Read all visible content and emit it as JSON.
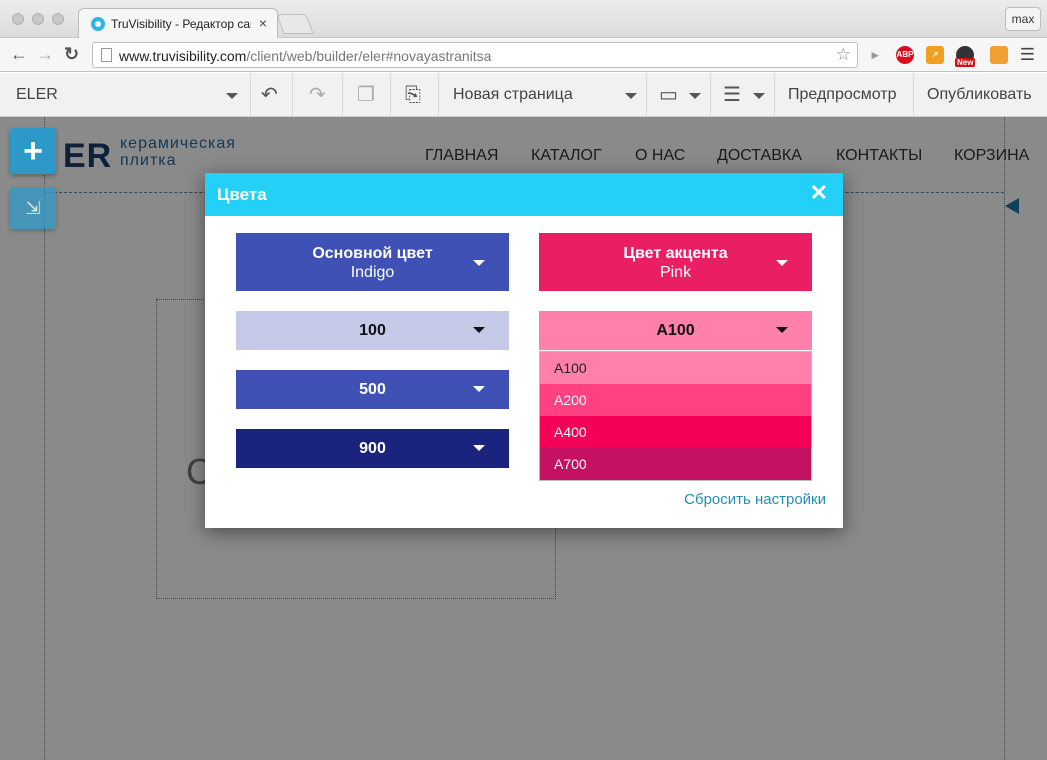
{
  "browser": {
    "tab_title": "TruVisibility - Редактор сай",
    "tab_close": "×",
    "profile": "max",
    "url_host": "www.truvisibility.com",
    "url_path": "/client/web/builder/eler#novayastranitsa",
    "extensions": [
      "volume-icon",
      "adblock-icon",
      "chart-icon",
      "new-badge-icon",
      "grid-icon"
    ],
    "adblock_label": "ABP",
    "new_label": "New"
  },
  "toolbar": {
    "site_name": "ELER",
    "page_select": "Новая страница",
    "preview": "Предпросмотр",
    "publish": "Опубликовать"
  },
  "site": {
    "logo_mark": "ER",
    "logo_line1": "керамическая",
    "logo_line2": "плитка",
    "nav": [
      "ГЛАВНАЯ",
      "КАТАЛОГ",
      "О НАС",
      "ДОСТАВКА",
      "КОНТАКТЫ",
      "КОРЗИНА"
    ],
    "bg_letter": "C"
  },
  "modal": {
    "title": "Цвета",
    "primary": {
      "label": "Основной цвет",
      "value": "Indigo",
      "color": "#3f51b5"
    },
    "accent": {
      "label": "Цвет акцента",
      "value": "Pink",
      "color": "#e91e63"
    },
    "primary_shades": [
      {
        "label": "100",
        "color": "#c5cae9",
        "text": "#111111"
      },
      {
        "label": "500",
        "color": "#3f51b5",
        "text": "#ffffff"
      },
      {
        "label": "900",
        "color": "#1a237e",
        "text": "#ffffff"
      }
    ],
    "accent_shade": {
      "label": "A100",
      "color": "#ff80ab"
    },
    "accent_options": [
      {
        "label": "A100",
        "color": "#ff80ab",
        "text": "#222222"
      },
      {
        "label": "A200",
        "color": "#ff4081",
        "text": "#ffffff"
      },
      {
        "label": "A400",
        "color": "#f50057",
        "text": "#ffffff"
      },
      {
        "label": "A700",
        "color": "#c51162",
        "text": "#ffffff"
      }
    ],
    "reset": "Сбросить настройки"
  }
}
